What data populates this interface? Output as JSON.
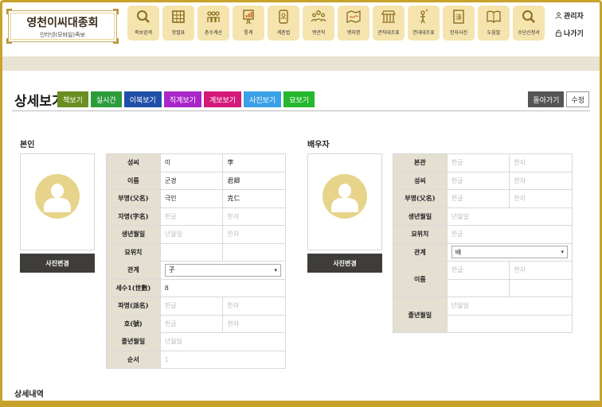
{
  "logo": {
    "title": "영천이씨대종회",
    "subtitle": "인터넷(모바일)족보"
  },
  "nav": [
    {
      "label": "족보검색",
      "icon": "search-icon"
    },
    {
      "label": "항렬표",
      "icon": "grid-table-icon"
    },
    {
      "label": "촌수계산",
      "icon": "family-icon"
    },
    {
      "label": "통계",
      "icon": "chart-board-icon"
    },
    {
      "label": "계촌법",
      "icon": "phone-person-icon"
    },
    {
      "label": "엣관직",
      "icon": "people-group-icon"
    },
    {
      "label": "엣지명",
      "icon": "map-icon"
    },
    {
      "label": "관직대조표",
      "icon": "building-icon"
    },
    {
      "label": "연대대조표",
      "icon": "person-torch-icon"
    },
    {
      "label": "한자사전",
      "icon": "dictionary-icon"
    },
    {
      "label": "도움말",
      "icon": "book-icon"
    },
    {
      "label": "수단신청서",
      "icon": "search-form-icon"
    }
  ],
  "util": {
    "admin": "관리자",
    "logout": "나가기"
  },
  "page": {
    "title": "상세보기",
    "tabs": [
      {
        "label": "책보기",
        "color": "#6b8e23"
      },
      {
        "label": "실시간",
        "color": "#2e9c3c"
      },
      {
        "label": "이복보기",
        "color": "#1f4fa8"
      },
      {
        "label": "직계보기",
        "color": "#a827c9"
      },
      {
        "label": "계보보기",
        "color": "#d4197a"
      },
      {
        "label": "사진보기",
        "color": "#3aa0e8"
      },
      {
        "label": "묘보기",
        "color": "#25b82d"
      }
    ],
    "back_label": "돌아가기",
    "edit_label": "수정"
  },
  "self": {
    "section_label": "본인",
    "photo_button": "사진변경",
    "rows": [
      {
        "label": "성씨",
        "v1": "이",
        "v2": "李"
      },
      {
        "label": "이름",
        "v1": "군경",
        "v2": "君卿"
      },
      {
        "label": "부명(父名)",
        "v1": "극인",
        "v2": "克仁"
      },
      {
        "label": "자명(字名)",
        "p1": "한글",
        "p2": "한자"
      },
      {
        "label": "생년월일",
        "p1": "년월일",
        "p2": "한자"
      },
      {
        "label": "묘위치"
      },
      {
        "label": "관계",
        "select": "子"
      },
      {
        "label": "세수1(世數)",
        "v1": "8"
      },
      {
        "label": "파명(派名)",
        "p1": "한글",
        "p2": "한자"
      },
      {
        "label": "호(號)",
        "p1": "한글",
        "p2": "한자"
      },
      {
        "label": "졸년월일",
        "p1": "년월일"
      },
      {
        "label": "순서",
        "p1": "1"
      }
    ]
  },
  "spouse": {
    "section_label": "배우자",
    "photo_button": "사진변경",
    "rows": [
      {
        "label": "본관",
        "p1": "한글",
        "p2": "한자"
      },
      {
        "label": "성씨",
        "p1": "한글",
        "p2": "한자"
      },
      {
        "label": "부명(父名)",
        "p1": "한글",
        "p2": "한자"
      },
      {
        "label": "생년월일",
        "p1": "년월일"
      },
      {
        "label": "묘위치",
        "p1": "한글"
      },
      {
        "label": "관계",
        "select": "배"
      },
      {
        "label": "이름",
        "p1": "한글",
        "p2": "한자"
      },
      {
        "label": ""
      },
      {
        "label": "졸년월일",
        "p1": "년월일"
      },
      {
        "label": ""
      }
    ]
  },
  "bottom_label": "상세내역"
}
